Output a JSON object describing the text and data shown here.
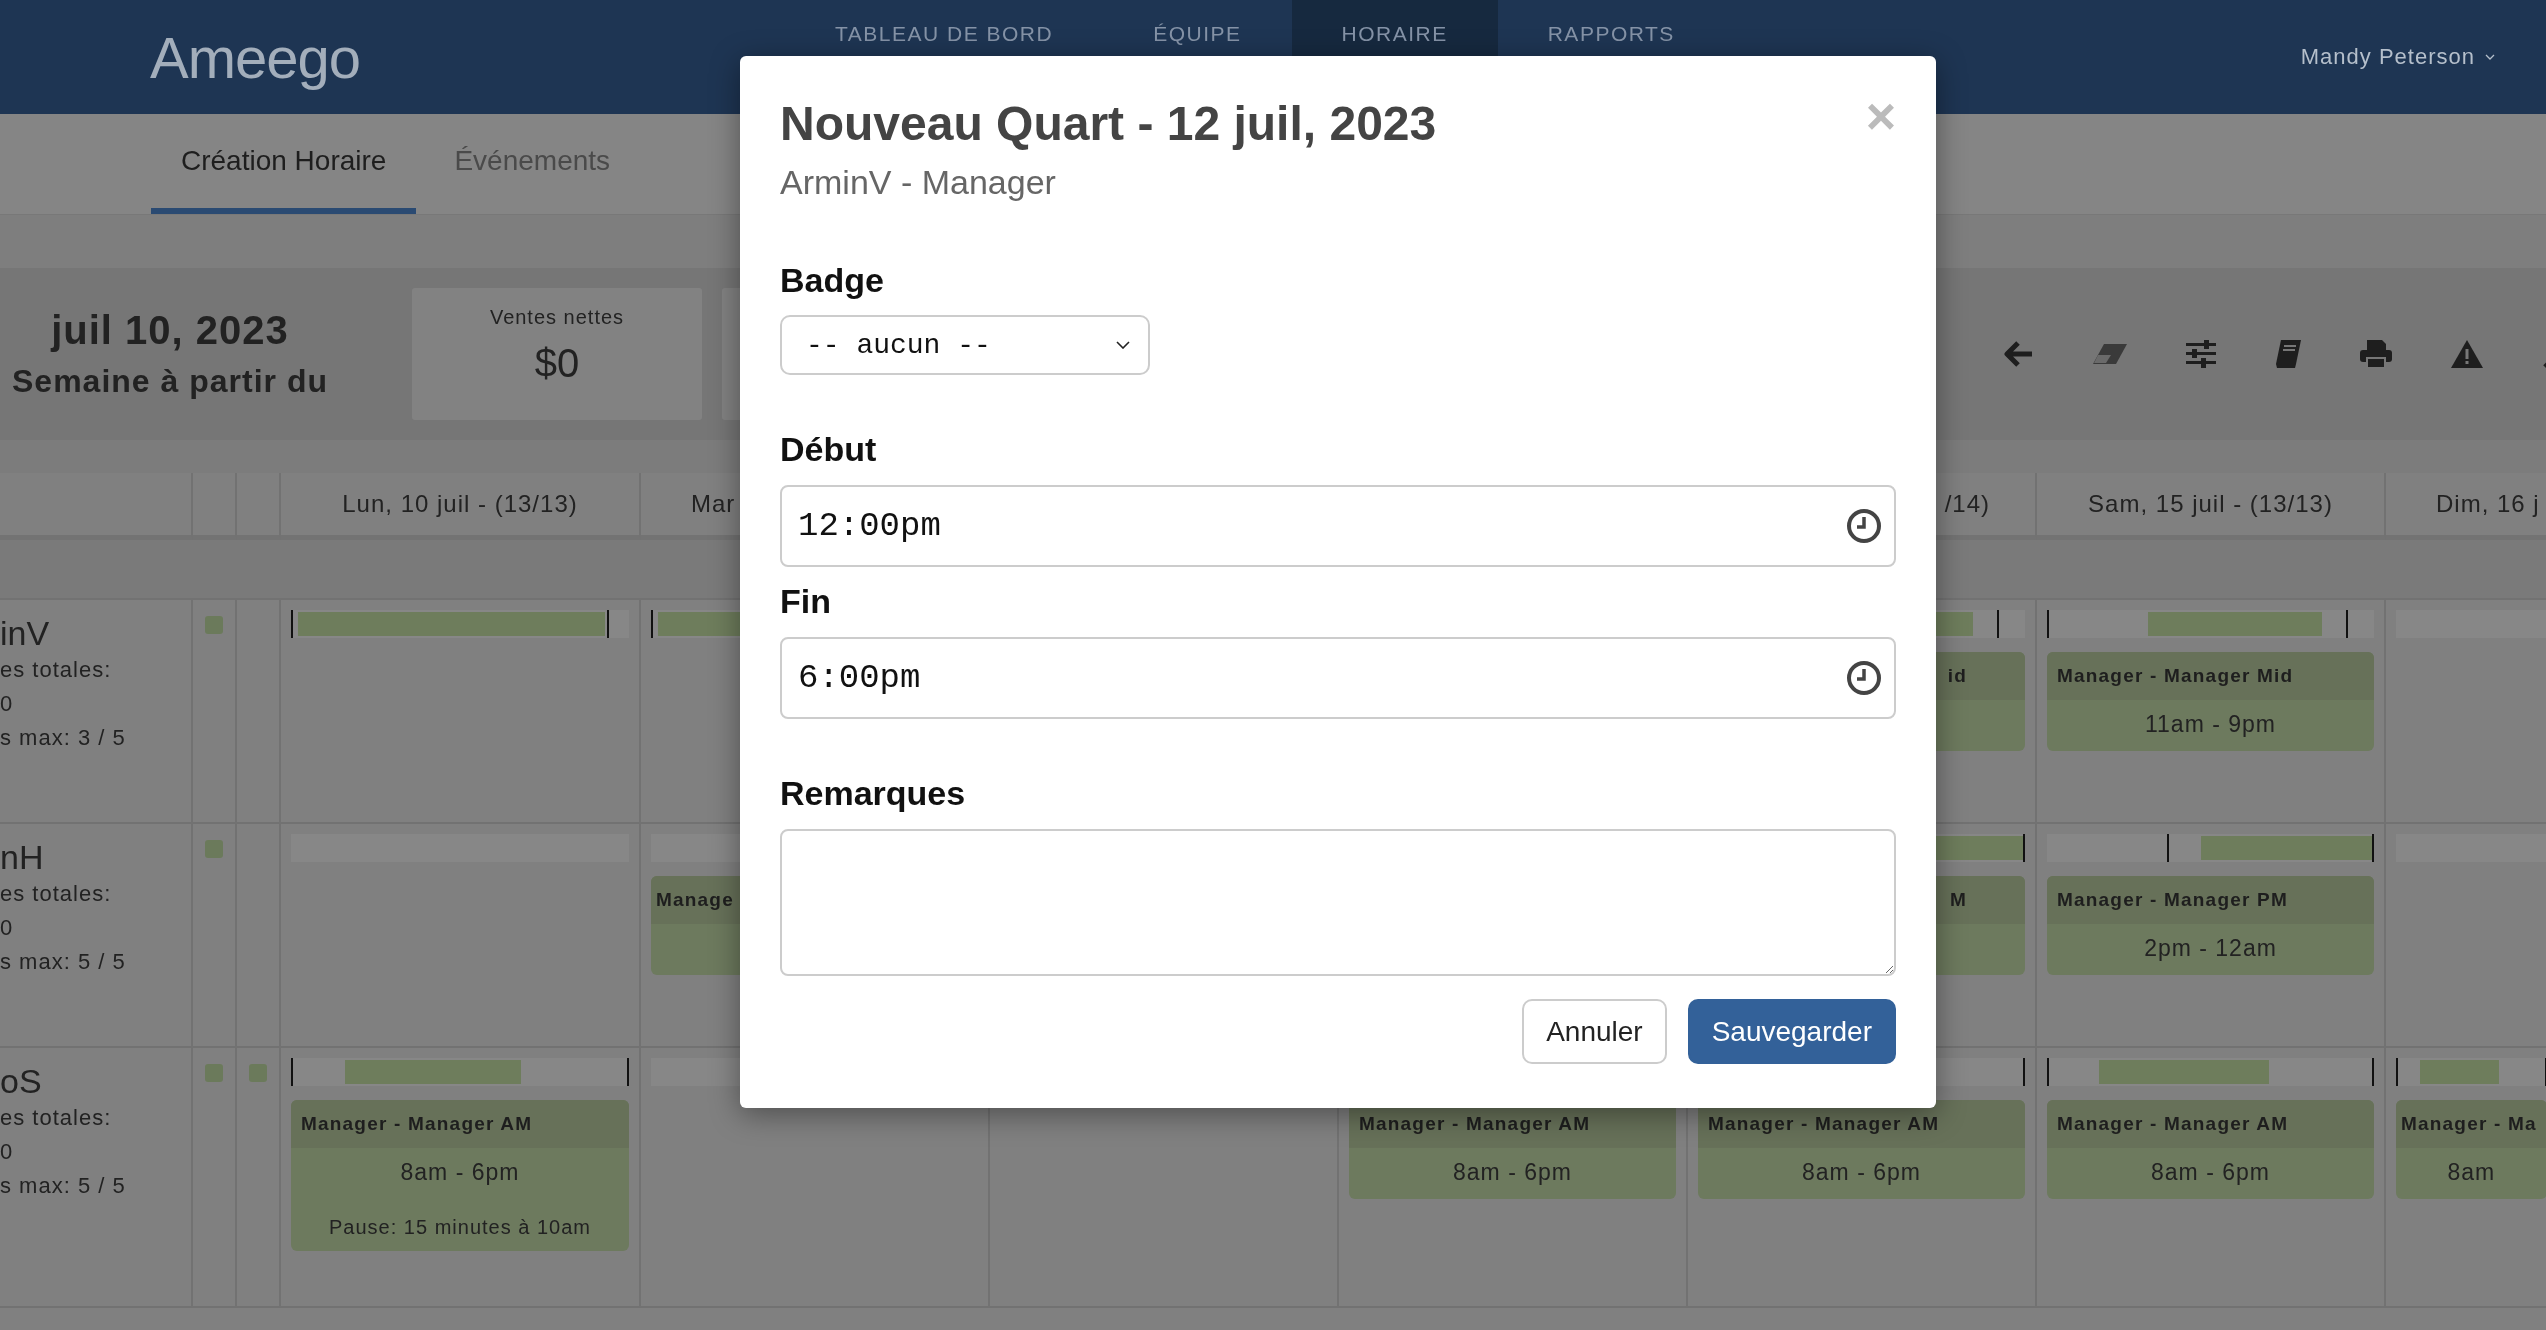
{
  "header": {
    "logo": "Ameego",
    "nav": [
      {
        "label": "TABLEAU DE BORD",
        "selected": false
      },
      {
        "label": "ÉQUIPE",
        "selected": false
      },
      {
        "label": "HORAIRE",
        "selected": true
      },
      {
        "label": "RAPPORTS",
        "selected": false
      }
    ],
    "user": "Mandy Peterson"
  },
  "subnav": [
    {
      "label": "Création Horaire",
      "selected": true
    },
    {
      "label": "Événements",
      "selected": false
    }
  ],
  "summary": {
    "week_date": "juil 10, 2023",
    "week_label": "Semaine à partir du",
    "cards": [
      {
        "label": "Ventes nettes",
        "value": "$0"
      }
    ]
  },
  "schedule": {
    "days": [
      {
        "label": "Lun, 10 juil - (13/13)",
        "kind": "normal"
      },
      {
        "label": "Mar",
        "kind": "cut_end"
      },
      {
        "kind": "hidden"
      },
      {
        "kind": "hidden"
      },
      {
        "label": "/14)",
        "kind": "cut_start"
      },
      {
        "label": "Sam, 15 juil - (13/13)",
        "kind": "normal"
      },
      {
        "label": "Dim, 16 j",
        "kind": "cut_end"
      }
    ],
    "rows": [
      {
        "name": "inV",
        "stats": [
          "es totales:",
          "0",
          "s max: 3 / 5"
        ],
        "marker_a": true,
        "marker_b": false,
        "cells": [
          {
            "kind": "avail"
          },
          {
            "kind": "avail"
          },
          {
            "kind": "covered"
          },
          {
            "kind": "none"
          },
          {
            "kind": "mid",
            "shift": {
              "title": "id",
              "kind": "cut_start"
            }
          },
          {
            "kind": "mid",
            "shift": {
              "title": "Manager - Manager Mid",
              "time": "11am - 9pm",
              "kind": "normal"
            }
          },
          {
            "kind": "blank"
          }
        ]
      },
      {
        "name": "nH",
        "stats": [
          "es totales:",
          "0",
          "s max: 5 / 5"
        ],
        "marker_a": true,
        "marker_b": false,
        "cells": [
          {
            "kind": "blank"
          },
          {
            "kind": "blank",
            "shift": {
              "title": "Manage",
              "kind": "cut_end"
            }
          },
          {
            "kind": "none"
          },
          {
            "kind": "none"
          },
          {
            "kind": "pm",
            "shift": {
              "title": "M",
              "kind": "cut_start"
            }
          },
          {
            "kind": "pm",
            "shift": {
              "title": "Manager - Manager PM",
              "time": "2pm - 12am",
              "kind": "normal"
            }
          },
          {
            "kind": "blank"
          }
        ]
      },
      {
        "name": "oS",
        "stats": [
          "es totales:",
          "0",
          "s max: 5 / 5"
        ],
        "marker_a": true,
        "marker_b": true,
        "cells": [
          {
            "kind": "am",
            "shift": {
              "title": "Manager - Manager AM",
              "time": "8am - 6pm",
              "pause": "Pause: 15 minutes à 10am",
              "kind": "normal"
            }
          },
          {
            "kind": "blank"
          },
          {
            "kind": "none"
          },
          {
            "kind": "none",
            "shift": {
              "title": "Manager - Manager AM",
              "time": "8am - 6pm",
              "kind": "normal"
            }
          },
          {
            "kind": "end_tick",
            "shift": {
              "title": "Manager - Manager AM",
              "time": "8am - 6pm",
              "kind": "normal"
            }
          },
          {
            "kind": "am",
            "shift": {
              "title": "Manager - Manager AM",
              "time": "8am - 6pm",
              "kind": "normal"
            }
          },
          {
            "kind": "am",
            "shift": {
              "title": "Manager - Ma",
              "time": "8am",
              "kind": "cut_end"
            }
          }
        ]
      }
    ]
  },
  "modal": {
    "title": "Nouveau Quart - 12 juil, 2023",
    "subtitle": "ArminV - Manager",
    "close": "×",
    "badge": {
      "label": "Badge",
      "value": "-- aucun --"
    },
    "start": {
      "label": "Début",
      "value": "12:00pm"
    },
    "end": {
      "label": "Fin",
      "value": "6:00pm"
    },
    "remarks": {
      "label": "Remarques"
    },
    "buttons": [
      {
        "label": "Annuler",
        "kind": "secondary"
      },
      {
        "label": "Sauvegarder",
        "kind": "primary"
      }
    ]
  }
}
